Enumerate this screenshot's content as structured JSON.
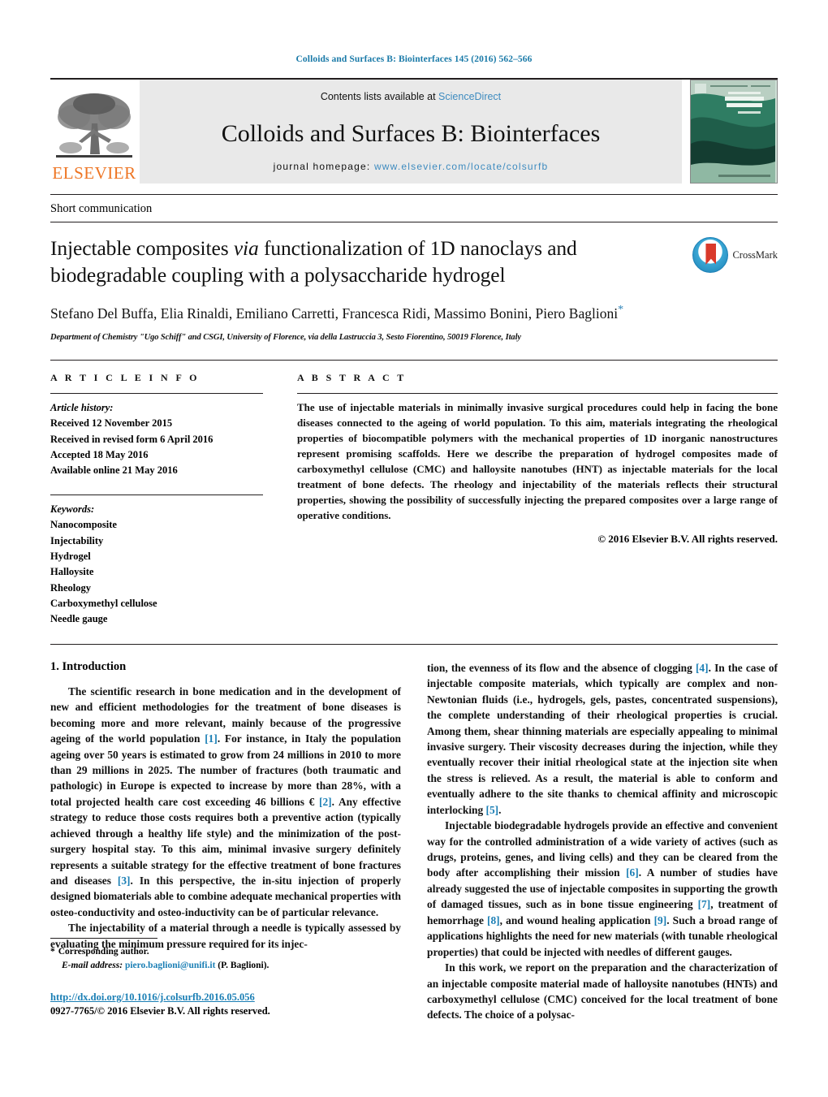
{
  "running_head": "Colloids and Surfaces B: Biointerfaces 145 (2016) 562–566",
  "masthead": {
    "contents_prefix": "Contents lists available at ",
    "sciencedirect": "ScienceDirect",
    "journal_title": "Colloids and Surfaces B: Biointerfaces",
    "homepage_prefix": "journal homepage: ",
    "homepage_url": "www.elsevier.com/locate/colsurfb",
    "publisher_name": "ELSEVIER",
    "publisher_logo_icon": "elsevier-tree-icon",
    "cover_icon": "journal-cover-thumbnail",
    "cover_title_line1": "COLLOIDS AND",
    "cover_title_line2": "SURFACES B",
    "link_color": "#3e8bbf"
  },
  "article_type": "Short communication",
  "title": {
    "part1": "Injectable composites ",
    "italic": "via",
    "part2": " functionalization of 1D nanoclays and biodegradable coupling with a polysaccharide hydrogel"
  },
  "authors": "Stefano Del Buffa, Elia Rinaldi, Emiliano Carretti, Francesca Ridi, Massimo Bonini, Piero Baglioni",
  "corresponding_marker": "*",
  "affiliation": "Department of Chemistry \"Ugo Schiff\" and CSGI, University of Florence, via della Lastruccia 3, Sesto Fiorentino, 50019 Florence, Italy",
  "crossmark": {
    "label": "CrossMark",
    "icon": "crossmark-icon"
  },
  "article_info": {
    "heading": "A R T I C L E    I N F O",
    "history_label": "Article history:",
    "history": [
      "Received 12 November 2015",
      "Received in revised form 6 April 2016",
      "Accepted 18 May 2016",
      "Available online 21 May 2016"
    ],
    "keywords_label": "Keywords:",
    "keywords": [
      "Nanocomposite",
      "Injectability",
      "Hydrogel",
      "Halloysite",
      "Rheology",
      "Carboxymethyl cellulose",
      "Needle gauge"
    ]
  },
  "abstract": {
    "heading": "A B S T R A C T",
    "text": "The use of injectable materials in minimally invasive surgical procedures could help in facing the bone diseases connected to the ageing of world population. To this aim, materials integrating the rheological properties of biocompatible polymers with the mechanical properties of 1D inorganic nanostructures represent promising scaffolds. Here we describe the preparation of hydrogel composites made of carboxymethyl cellulose (CMC) and halloysite nanotubes (HNT) as injectable materials for the local treatment of bone defects. The rheology and injectability of the materials reflects their structural properties, showing the possibility of successfully injecting the prepared composites over a large range of operative conditions.",
    "copyright": "© 2016 Elsevier B.V. All rights reserved."
  },
  "body": {
    "section_number_title": "1.  Introduction",
    "left_paragraphs": [
      {
        "segments": [
          {
            "t": "The scientific research in bone medication and in the development of new and efficient methodologies for the treatment of bone diseases is becoming more and more relevant, mainly because of the progressive ageing of the world population "
          },
          {
            "t": "[1]",
            "ref": true
          },
          {
            "t": ". For instance, in Italy the population ageing over 50 years is estimated to grow from 24 millions in 2010 to more than 29 millions in 2025. The number of fractures (both traumatic and pathologic) in Europe is expected to increase by more than 28%, with a total projected health care cost exceeding 46 billions € "
          },
          {
            "t": "[2]",
            "ref": true
          },
          {
            "t": ". Any effective strategy to reduce those costs requires both a preventive action (typically achieved through a healthy life style) and the minimization of the post-surgery hospital stay. To this aim, minimal invasive surgery definitely represents a suitable strategy for the effective treatment of bone fractures and diseases "
          },
          {
            "t": "[3]",
            "ref": true
          },
          {
            "t": ". In this perspective, the in-situ injection of properly designed biomaterials able to combine adequate mechanical properties with osteo-conductivity and osteo-inductivity can be of particular relevance."
          }
        ]
      },
      {
        "segments": [
          {
            "t": "The injectability of a material through a needle is typically assessed by evaluating the minimum pressure required for its injec-"
          }
        ]
      }
    ],
    "right_paragraphs": [
      {
        "cont": true,
        "segments": [
          {
            "t": "tion, the evenness of its flow and the absence of clogging "
          },
          {
            "t": "[4]",
            "ref": true
          },
          {
            "t": ". In the case of injectable composite materials, which typically are complex and non-Newtonian fluids (i.e., hydrogels, gels, pastes, concentrated suspensions), the complete understanding of their rheological properties is crucial. Among them, shear thinning materials are especially appealing to minimal invasive surgery. Their viscosity decreases during the injection, while they eventually recover their initial rheological state at the injection site when the stress is relieved. As a result, the material is able to conform and eventually adhere to the site thanks to chemical affinity and microscopic interlocking "
          },
          {
            "t": "[5]",
            "ref": true
          },
          {
            "t": "."
          }
        ]
      },
      {
        "segments": [
          {
            "t": "Injectable biodegradable hydrogels provide an effective and convenient way for the controlled administration of a wide variety of actives (such as drugs, proteins, genes, and living cells) and they can be cleared from the body after accomplishing their mission "
          },
          {
            "t": "[6]",
            "ref": true
          },
          {
            "t": ". A number of studies have already suggested the use of injectable composites in supporting the growth of damaged tissues, such as in bone tissue engineering "
          },
          {
            "t": "[7]",
            "ref": true
          },
          {
            "t": ", treatment of hemorrhage "
          },
          {
            "t": "[8]",
            "ref": true
          },
          {
            "t": ", and wound healing application "
          },
          {
            "t": "[9]",
            "ref": true
          },
          {
            "t": ". Such a broad range of applications highlights the need for new materials (with tunable rheological properties) that could be injected with needles of different gauges."
          }
        ]
      },
      {
        "segments": [
          {
            "t": "In this work, we report on the preparation and the characterization of an injectable composite material made of halloysite nanotubes (HNTs) and carboxymethyl cellulose (CMC) conceived for the local treatment of bone defects. The choice of a polysac-"
          }
        ]
      }
    ]
  },
  "footnote": {
    "corresponding_star": "*",
    "corresponding_text": "Corresponding author.",
    "email_label": "E-mail address:",
    "email": "piero.baglioni@unifi.it",
    "email_suffix": "(P. Baglioni).",
    "doi": "http://dx.doi.org/10.1016/j.colsurfb.2016.05.056",
    "issn_line": "0927-7765/© 2016 Elsevier B.V. All rights reserved."
  }
}
